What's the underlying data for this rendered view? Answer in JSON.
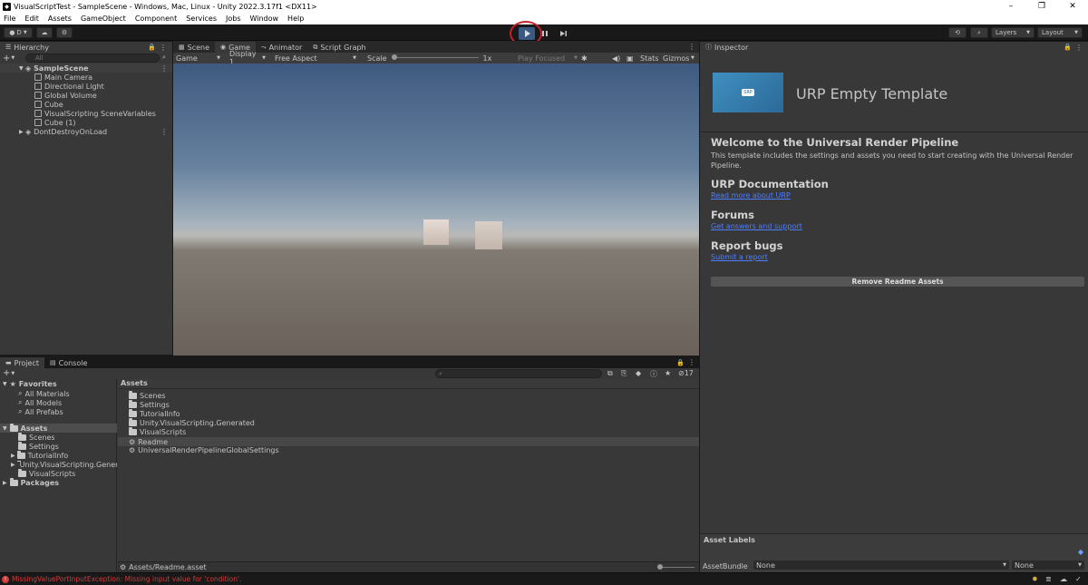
{
  "window": {
    "title": "VisualScriptTest - SampleScene - Windows, Mac, Linux - Unity 2022.3.17f1 <DX11>",
    "controls": [
      "–",
      "❐",
      "✕"
    ]
  },
  "menu": [
    "File",
    "Edit",
    "Assets",
    "GameObject",
    "Component",
    "Services",
    "Jobs",
    "Window",
    "Help"
  ],
  "toolbar": {
    "account": "D",
    "layers": "Layers",
    "layout": "Layout"
  },
  "hierarchy": {
    "tab": "Hierarchy",
    "search_placeholder": "All",
    "scene": "SampleScene",
    "items": [
      "Main Camera",
      "Directional Light",
      "Global Volume",
      "Cube",
      "VisualScripting SceneVariables",
      "Cube (1)"
    ],
    "dontdestroy": "DontDestroyOnLoad"
  },
  "center_tabs": [
    "Scene",
    "Game",
    "Animator",
    "Script Graph"
  ],
  "game_toolbar": {
    "mode": "Game",
    "display": "Display 1",
    "aspect": "Free Aspect",
    "scale_label": "Scale",
    "scale_value": "1x",
    "play_focused": "Play Focused",
    "stats": "Stats",
    "gizmos": "Gizmos"
  },
  "inspector": {
    "tab": "Inspector",
    "logo_text": "SRP",
    "title": "URP Empty Template",
    "welcome_heading": "Welcome to the Universal Render Pipeline",
    "welcome_body": "This template includes the settings and assets you need to start creating with the Universal Render Pipeline.",
    "doc_heading": "URP Documentation",
    "doc_link": "Read more about URP",
    "forums_heading": "Forums",
    "forums_link": "Get answers and support",
    "bugs_heading": "Report bugs",
    "bugs_link": "Submit a report",
    "remove_button": "Remove Readme Assets",
    "asset_labels": "Asset Labels",
    "asset_bundle_label": "AssetBundle",
    "asset_bundle_value": "None",
    "asset_bundle_variant": "None"
  },
  "project": {
    "tabs": [
      "Project",
      "Console"
    ],
    "count": "17",
    "favorites": "Favorites",
    "favorite_items": [
      "All Materials",
      "All Models",
      "All Prefabs"
    ],
    "assets_root": "Assets",
    "tree_folders": [
      "Scenes",
      "Settings",
      "TutorialInfo",
      "Unity.VisualScripting.Genera",
      "VisualScripts"
    ],
    "packages": "Packages",
    "breadcrumb": "Assets",
    "files": [
      "Scenes",
      "Settings",
      "TutorialInfo",
      "Unity.VisualScripting.Generated",
      "VisualScripts",
      "Readme",
      "UniversalRenderPipelineGlobalSettings"
    ],
    "footer_path": "Assets/Readme.asset"
  },
  "status": {
    "error": "MissingValuePortInputException: Missing input value for 'condition'."
  },
  "colors": {
    "play_active": "#3a5a82",
    "highlight_ring": "#c8202a",
    "link": "#4c7eff",
    "error": "#d03b3b"
  }
}
